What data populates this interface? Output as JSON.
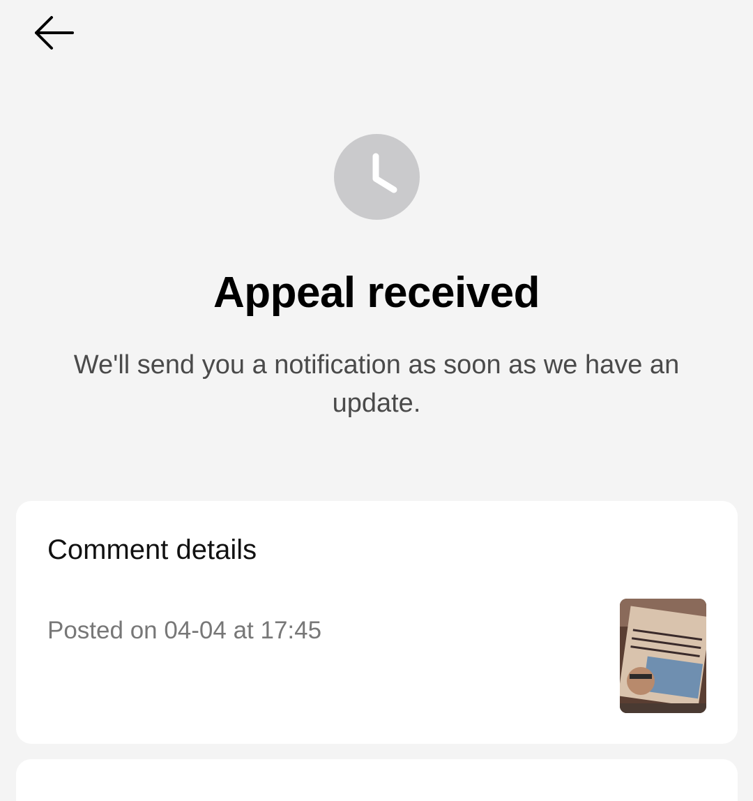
{
  "header": {
    "back_icon": "arrow-left-icon"
  },
  "status": {
    "icon": "clock-icon",
    "icon_color": "#cacacc",
    "title": "Appeal received",
    "subtitle": "We'll send you a notification as soon as we have an update."
  },
  "comment_card": {
    "title": "Comment details",
    "posted": "Posted on 04-04 at 17:45",
    "thumbnail_icon": "video-thumbnail"
  }
}
